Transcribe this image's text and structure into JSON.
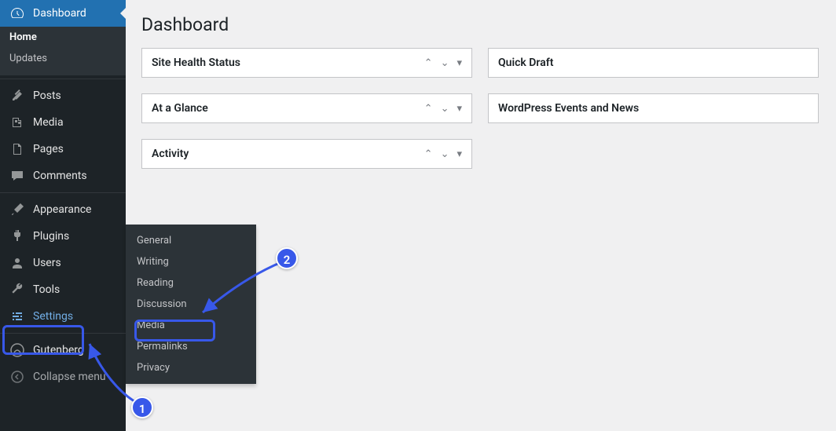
{
  "sidebar": {
    "dashboard": "Dashboard",
    "home": "Home",
    "updates": "Updates",
    "posts": "Posts",
    "media": "Media",
    "pages": "Pages",
    "comments": "Comments",
    "appearance": "Appearance",
    "plugins": "Plugins",
    "users": "Users",
    "tools": "Tools",
    "settings": "Settings",
    "gutenberg": "Gutenberg",
    "collapse": "Collapse menu"
  },
  "settings_submenu": {
    "general": "General",
    "writing": "Writing",
    "reading": "Reading",
    "discussion": "Discussion",
    "media": "Media",
    "permalinks": "Permalinks",
    "privacy": "Privacy"
  },
  "page": {
    "title": "Dashboard"
  },
  "widgets": {
    "health": "Site Health Status",
    "glance": "At a Glance",
    "activity": "Activity",
    "draft": "Quick Draft",
    "news": "WordPress Events and News"
  },
  "annotations": {
    "one": "1",
    "two": "2"
  }
}
